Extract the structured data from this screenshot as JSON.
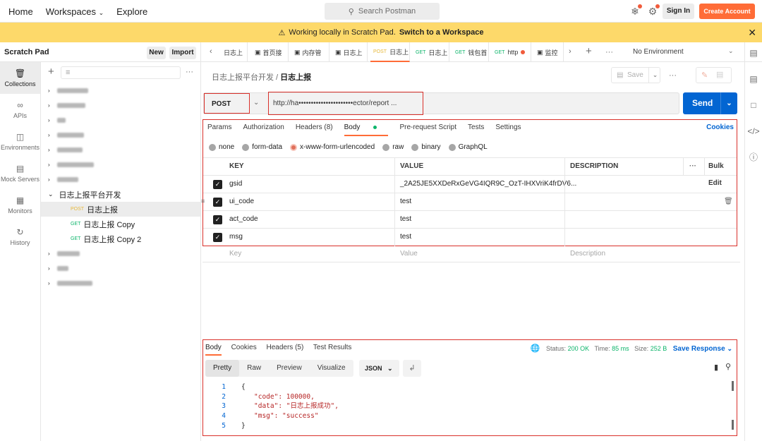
{
  "topbar": {
    "nav": [
      "Home",
      "Workspaces",
      "Explore"
    ],
    "search_placeholder": "Search Postman",
    "sign_in": "Sign In",
    "create_account": "Create Account"
  },
  "banner": {
    "text": "Working locally in Scratch Pad.",
    "link": "Switch to a Workspace"
  },
  "sidebar": {
    "title": "Scratch Pad",
    "new_label": "New",
    "import_label": "Import",
    "rail": [
      {
        "label": "Collections",
        "icon": "collections-icon"
      },
      {
        "label": "APIs",
        "icon": "apis-icon"
      },
      {
        "label": "Environments",
        "icon": "environments-icon"
      },
      {
        "label": "Mock Servers",
        "icon": "mock-servers-icon"
      },
      {
        "label": "Monitors",
        "icon": "monitors-icon"
      },
      {
        "label": "History",
        "icon": "history-icon"
      }
    ],
    "collection": "日志上报平台开发",
    "requests": [
      {
        "method": "POST",
        "name": "日志上报"
      },
      {
        "method": "GET",
        "name": "日志上报 Copy"
      },
      {
        "method": "GET",
        "name": "日志上报 Copy 2"
      }
    ]
  },
  "tabs": {
    "items": [
      {
        "method": "",
        "label": "日志上"
      },
      {
        "method": "",
        "label": "首页接"
      },
      {
        "method": "",
        "label": "内存管"
      },
      {
        "method": "",
        "label": "日志上"
      },
      {
        "method": "POST",
        "label": "日志上"
      },
      {
        "method": "GET",
        "label": "日志上"
      },
      {
        "method": "GET",
        "label": "钱包首"
      },
      {
        "method": "GET",
        "label": "http"
      },
      {
        "method": "",
        "label": "监控"
      }
    ],
    "environment": "No Environment"
  },
  "request": {
    "breadcrumb_parent": "日志上报平台开发",
    "breadcrumb_current": "日志上报",
    "save_label": "Save",
    "method": "POST",
    "url": "http://ha••••••••••••••••••••••ector/report ...",
    "send_label": "Send",
    "tabs": [
      "Params",
      "Authorization",
      "Headers (8)",
      "Body",
      "Pre-request Script",
      "Tests",
      "Settings"
    ],
    "cookies_label": "Cookies",
    "body_modes": [
      "none",
      "form-data",
      "x-www-form-urlencoded",
      "raw",
      "binary",
      "GraphQL"
    ],
    "columns": {
      "key": "KEY",
      "value": "VALUE",
      "description": "DESCRIPTION",
      "bulk_edit": "Bulk Edit"
    },
    "params": [
      {
        "key": "gsid",
        "value": "_2A25JE5XXDeRxGeVG4IQR9C_OzT-IHXVriK4frDV6..."
      },
      {
        "key": "ui_code",
        "value": "test"
      },
      {
        "key": "act_code",
        "value": "test"
      },
      {
        "key": "msg",
        "value": "test"
      }
    ],
    "placeholders": {
      "key": "Key",
      "value": "Value",
      "description": "Description"
    }
  },
  "response": {
    "tabs": [
      "Body",
      "Cookies",
      "Headers (5)",
      "Test Results"
    ],
    "status_label": "Status:",
    "status_value": "200 OK",
    "time_label": "Time:",
    "time_value": "85 ms",
    "size_label": "Size:",
    "size_value": "252 B",
    "save_response": "Save Response",
    "views": [
      "Pretty",
      "Raw",
      "Preview",
      "Visualize"
    ],
    "format": "JSON",
    "lines": [
      "{",
      "\"code\": 100000,",
      "\"data\": \"日志上报成功\",",
      "\"msg\": \"success\"",
      "}"
    ]
  }
}
